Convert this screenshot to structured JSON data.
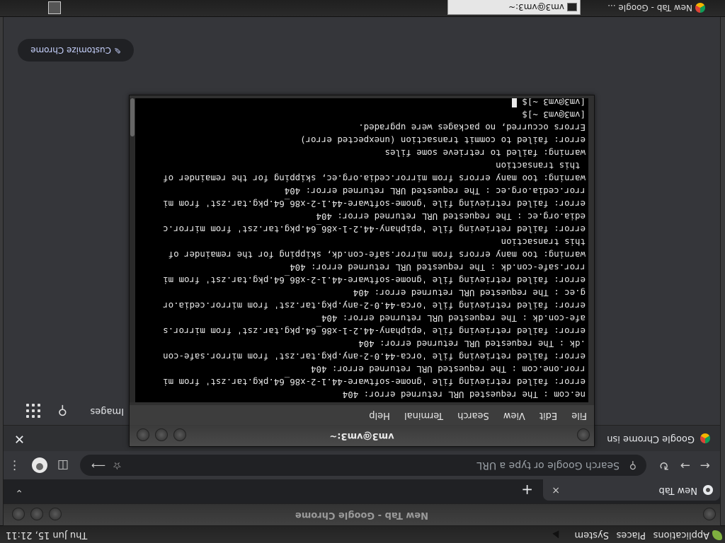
{
  "top_panel": {
    "menus": [
      "Applications",
      "Places",
      "System"
    ],
    "clock": "Thu Jun 15, 21:11"
  },
  "chrome": {
    "window_title": "New Tab - Google Chrome",
    "tab_title": "New Tab",
    "tab_close": "×",
    "new_tab": "+",
    "omnibox_placeholder": "Search Google or type a URL",
    "infobar_text": "Google Chrome isn",
    "infobar_close": "✕",
    "ntp_images": "Images",
    "customize": "Customize Chrome"
  },
  "terminal": {
    "title": "vm3@vm3:~",
    "menu": [
      "File",
      "Edit",
      "View",
      "Search",
      "Terminal",
      "Help"
    ],
    "lines": [
      "ne.com : The requested URL returned error: 404",
      "error: failed retrieving file 'gnome-software-44.1-2-x86_64.pkg.tar.zst' from mi",
      "rror.one.com : The requested URL returned error: 404",
      "error: failed retrieving file 'orca-44.0-2-any.pkg.tar.zst' from mirror.safe-con",
      ".dk : The requested URL returned error: 404",
      "error: failed retrieving file 'epiphany-44.2-1-x86_64.pkg.tar.zst' from mirror.s",
      "afe-con.dk : The requested URL returned error: 404",
      "error: failed retrieving file 'orca-44.0-2-any.pkg.tar.zst' from mirror.cedia.or",
      "g.ec : The requested URL returned error: 404",
      "error: failed retrieving file 'gnome-software-44.1-2-x86_64.pkg.tar.zst' from mi",
      "rror.safe-con.dk : The requested URL returned error: 404",
      "warning: too many errors from mirror.safe-con.dk, skipping for the remainder of",
      "this transaction",
      "error: failed retrieving file 'epiphany-44.2-1-x86_64.pkg.tar.zst' from mirror.c",
      "edia.org.ec : The requested URL returned error: 404",
      "error: failed retrieving file 'gnome-software-44.1-2-x86_64.pkg.tar.zst' from mi",
      "rror.cedia.org.ec : The requested URL returned error: 404",
      "warning: too many errors from mirror.cedia.org.ec, skipping for the remainder of",
      " this transaction",
      "warning: failed to retrieve some files",
      "error: failed to commit transaction (unexpected error)",
      "Errors occurred, no packages were upgraded.",
      "[vm3@vm3 ~]$",
      "[vm3@vm3 ~]$ "
    ]
  },
  "bottom_panel": {
    "tasks": [
      "New Tab - Google ...",
      "vm3@vm3:~"
    ]
  }
}
